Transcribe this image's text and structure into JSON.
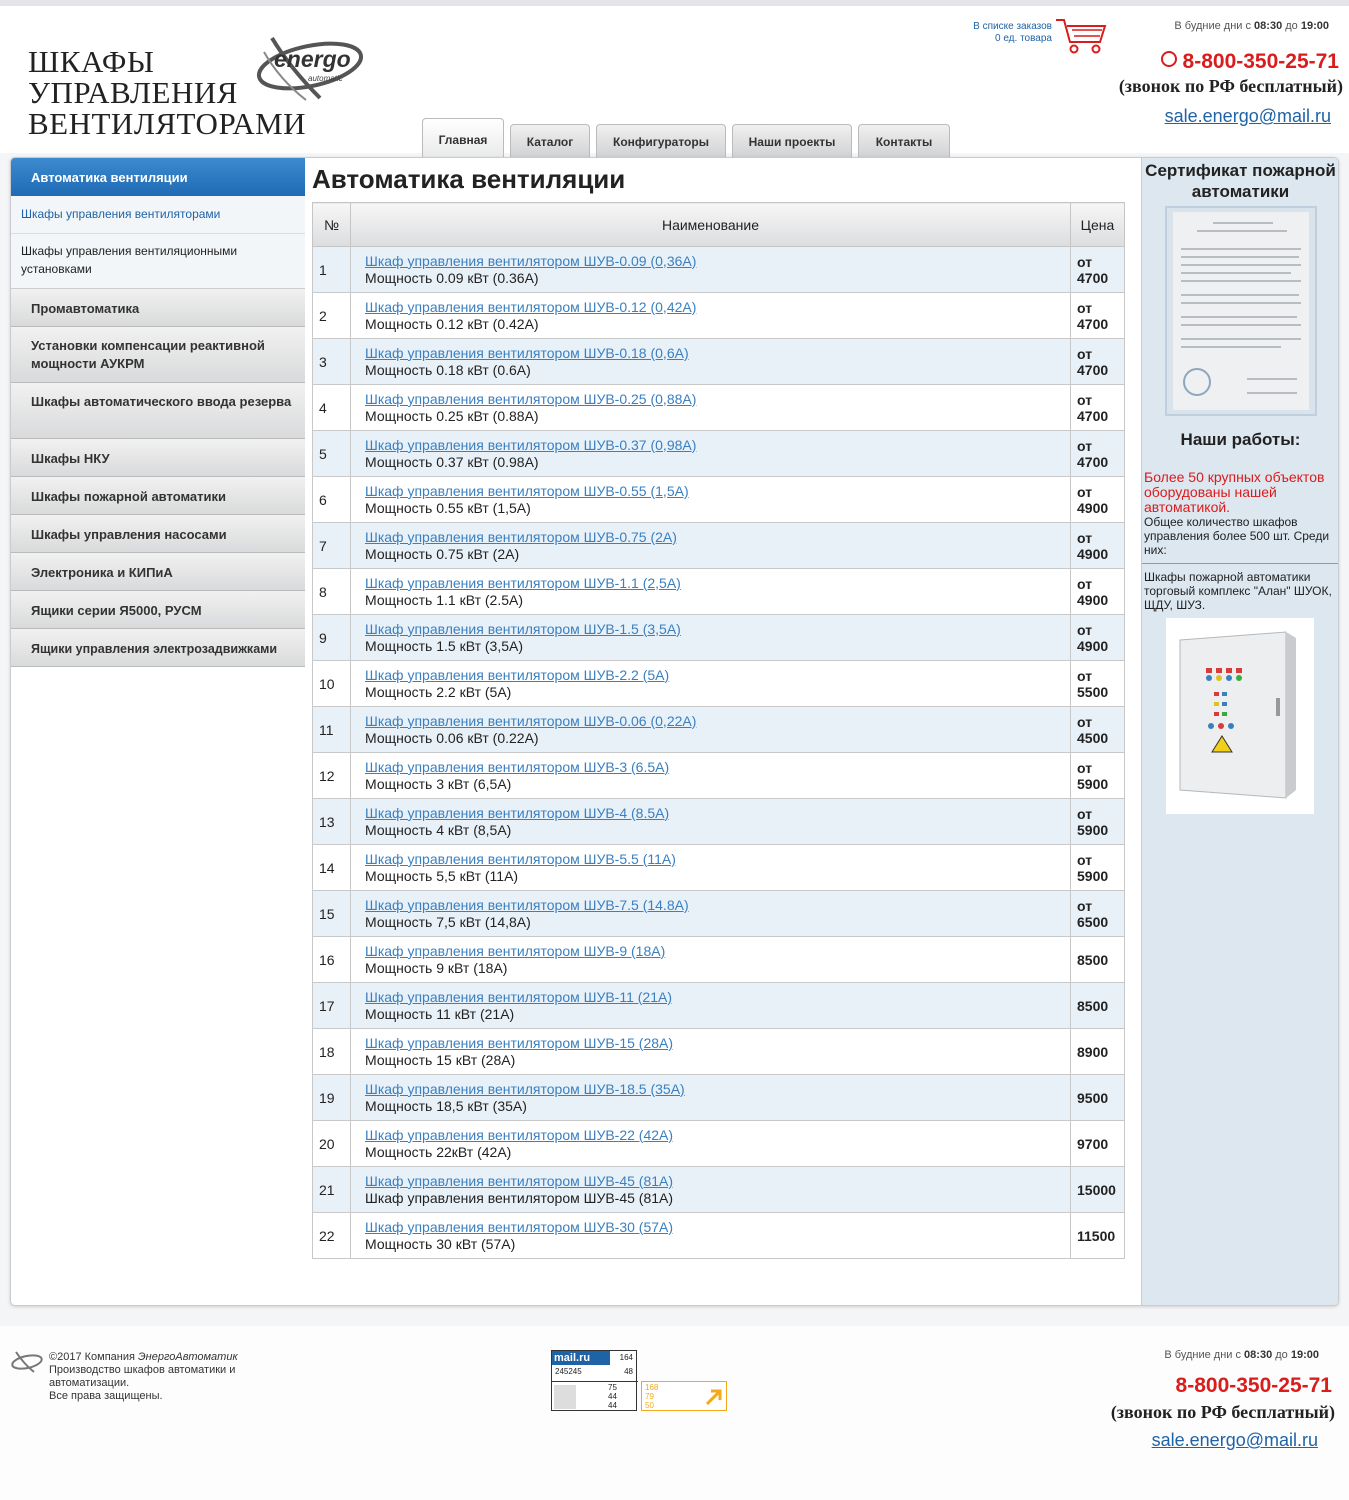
{
  "header": {
    "logo_lines": [
      "ШКАФЫ",
      "УПРАВЛЕНИЯ",
      "ВЕНТИЛЯТОРАМИ"
    ],
    "brand": "energo",
    "brand_sub": "automatic",
    "cart_line1": "В списке заказов",
    "cart_line2": "0 ед. товара",
    "hours_prefix": "В будние дни с",
    "hours_from": "08:30",
    "hours_mid": "до",
    "hours_to": "19:00",
    "phone": "8-800-350-25-71",
    "free_call": "(звонок по РФ бесплатный)",
    "email": "sale.energo@mail.ru"
  },
  "tabs": [
    "Главная",
    "Каталог",
    "Конфигураторы",
    "Наши проекты",
    "Контакты"
  ],
  "sidebar": {
    "active": "Автоматика вентиляции",
    "sub_link": "Шкафы управления вентиляторами",
    "sub_text": "Шкафы управления вентиляционными установками",
    "items": [
      "Промавтоматика",
      "Установки компенсации реактивной мощности АУКРМ",
      "Шкафы автоматического ввода резерва",
      "Шкафы НКУ",
      "Шкафы пожарной автоматики",
      "Шкафы управления насосами",
      "Электроника и КИПиА",
      "Ящики серии Я5000, РУСМ",
      "Ящики управления электрозадвижками"
    ]
  },
  "content": {
    "title": "Автоматика вентиляции",
    "col_num": "№",
    "col_name": "Наименование",
    "col_price": "Цена",
    "rows": [
      {
        "n": "1",
        "link": "Шкаф управления вентилятором ШУВ-0.09 (0,36А)",
        "desc": "Мощность 0.09 кВт (0.36А)",
        "from": "от",
        "price": "4700"
      },
      {
        "n": "2",
        "link": "Шкаф управления вентилятором ШУВ-0.12 (0,42А)",
        "desc": "Мощность 0.12 кВт (0.42А)",
        "from": "от",
        "price": "4700"
      },
      {
        "n": "3",
        "link": "Шкаф управления вентилятором ШУВ-0.18 (0,6А)",
        "desc": "Мощность 0.18 кВт (0.6А)",
        "from": "от",
        "price": "4700"
      },
      {
        "n": "4",
        "link": "Шкаф управления вентилятором ШУВ-0.25 (0,88А)",
        "desc": "Мощность 0.25 кВт (0.88А)",
        "from": "от",
        "price": "4700"
      },
      {
        "n": "5",
        "link": "Шкаф управления вентилятором ШУВ-0.37 (0,98А)",
        "desc": "Мощность 0.37 кВт (0.98А)",
        "from": "от",
        "price": "4700"
      },
      {
        "n": "6",
        "link": "Шкаф управления вентилятором ШУВ-0.55 (1,5А)",
        "desc": "Мощность 0.55 кВт (1,5А)",
        "from": "от",
        "price": "4900"
      },
      {
        "n": "7",
        "link": "Шкаф управления вентилятором ШУВ-0.75 (2А)",
        "desc": "Мощность 0.75 кВт (2А)",
        "from": "от",
        "price": "4900"
      },
      {
        "n": "8",
        "link": "Шкаф управления вентилятором ШУВ-1.1 (2,5А)",
        "desc": "Мощность 1.1 кВт (2.5А)",
        "from": "от",
        "price": "4900"
      },
      {
        "n": "9",
        "link": "Шкаф управления вентилятором ШУВ-1.5 (3,5А)",
        "desc": "Мощность  1.5 кВт (3,5А)",
        "from": "от",
        "price": "4900"
      },
      {
        "n": "10",
        "link": "Шкаф управления вентилятором ШУВ-2.2 (5А)",
        "desc": "Мощность 2.2 кВт (5А)",
        "from": "от",
        "price": "5500"
      },
      {
        "n": "11",
        "link": "Шкаф управления вентилятором ШУВ-0.06 (0,22А)",
        "desc": "Мощность 0.06 кВт (0.22А)",
        "from": "от",
        "price": "4500"
      },
      {
        "n": "12",
        "link": "Шкаф управления вентилятором ШУВ-3 (6.5А)",
        "desc": "Мощность 3 кВт (6,5А)",
        "from": "от",
        "price": "5900"
      },
      {
        "n": "13",
        "link": "Шкаф управления вентилятором ШУВ-4 (8.5А)",
        "desc": "Мощность 4 кВт (8,5А)",
        "from": "от",
        "price": "5900"
      },
      {
        "n": "14",
        "link": "Шкаф управления вентилятором ШУВ-5.5 (11А)",
        "desc": "Мощность 5,5 кВт (11А)",
        "from": "от",
        "price": "5900"
      },
      {
        "n": "15",
        "link": "Шкаф управления вентилятором ШУВ-7.5 (14.8А)",
        "desc": "Мощность 7,5 кВт (14,8А)",
        "from": "от",
        "price": "6500"
      },
      {
        "n": "16",
        "link": "Шкаф управления вентилятором ШУВ-9 (18А)",
        "desc": "Мощность 9 кВт (18А)",
        "from": "",
        "price": "8500"
      },
      {
        "n": "17",
        "link": "Шкаф управления вентилятором ШУВ-11 (21А)",
        "desc": "Мощность 11 кВт (21А)",
        "from": "",
        "price": "8500"
      },
      {
        "n": "18",
        "link": "Шкаф управления вентилятором ШУВ-15 (28А)",
        "desc": "Мощность 15 кВт (28А)",
        "from": "",
        "price": "8900"
      },
      {
        "n": "19",
        "link": "Шкаф управления вентилятором ШУВ-18.5 (35А)",
        "desc": "Мощность 18,5 кВт (35А)",
        "from": "",
        "price": "9500"
      },
      {
        "n": "20",
        "link": "Шкаф управления вентилятором ШУВ-22 (42А)",
        "desc": "Мощность 22кВт (42А)",
        "from": "",
        "price": "9700"
      },
      {
        "n": "21",
        "link": "Шкаф управления вентилятором ШУВ-45 (81А)",
        "desc": "Шкаф управления вентилятором ШУВ-45 (81А)",
        "from": "",
        "price": "15000"
      },
      {
        "n": "22",
        "link": "Шкаф управления вентилятором ШУВ-30 (57А)",
        "desc": "Мощность 30 кВт (57А)",
        "from": "",
        "price": "11500"
      }
    ]
  },
  "right": {
    "cert_title": "Сертификат пожарной автоматики",
    "works_title": "Наши работы:",
    "works_red": "Более 50 крупных объектов оборудованы нашей автоматикой.",
    "works_text": "Общее количество шкафов управления более 500 шт. Среди них:",
    "works_item": "Шкафы пожарной автоматики торговый комплекс \"Алан\" ШУОК, ЩДУ, ШУЗ."
  },
  "footer": {
    "copy_prefix": "©2017 Компания",
    "copy_company": "ЭнергоАвтоматик",
    "copy_line2": "Производство шкафов автоматики и автоматизации.",
    "copy_line3": "Все права защищены.",
    "counter_brand": "mail.ru",
    "counter1_a": "164",
    "counter1_b": "245245",
    "counter1_c": "48",
    "counter1_d": "75",
    "counter1_e": "44",
    "counter1_f": "44",
    "counter2_a": "168",
    "counter2_b": "79",
    "counter2_c": "50",
    "hours_prefix": "В будние дни с",
    "hours_from": "08:30",
    "hours_mid": "до",
    "hours_to": "19:00",
    "phone": "8-800-350-25-71",
    "free_call": "(звонок по РФ бесплатный)",
    "email": "sale.energo@mail.ru"
  },
  "colors": {
    "accent_blue": "#1f6bb4",
    "phone_red": "#d91c1c",
    "link_blue": "#1f63a7"
  }
}
